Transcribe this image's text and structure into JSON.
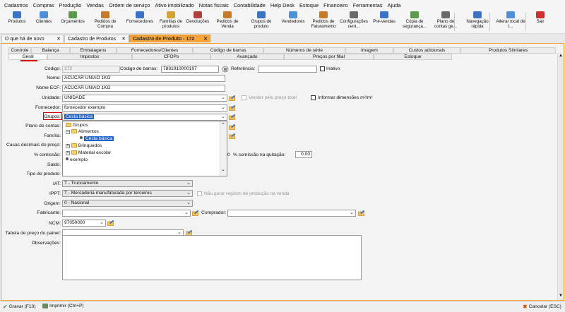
{
  "menu": [
    "Cadastros",
    "Compras",
    "Produção",
    "Vendas",
    "Ordem de serviço",
    "Ativo imobilizado",
    "Notas fiscais",
    "Contabilidade",
    "Help Desk",
    "Estoque",
    "Financeiro",
    "Ferramentas",
    "Ajuda"
  ],
  "toolbar": [
    {
      "label": "Produtos",
      "icon": "box-icon"
    },
    {
      "label": "Clientes",
      "icon": "clients-icon"
    },
    {
      "label": "Orçamentos",
      "icon": "quote-icon"
    },
    {
      "label": "Pedidos de Compra",
      "icon": "purchase-order-icon"
    },
    {
      "label": "Fornecedores",
      "icon": "supplier-icon"
    },
    {
      "label": "Famílias de produtos",
      "icon": "product-family-icon"
    },
    {
      "label": "Devoluções",
      "icon": "return-icon"
    },
    {
      "label": "Pedidos de Venda",
      "icon": "sales-order-icon"
    },
    {
      "label": "Grupos de produto",
      "icon": "product-group-icon"
    },
    {
      "label": "Vendedores",
      "icon": "seller-icon"
    },
    {
      "label": "Pedidos de Faturamento",
      "icon": "billing-icon"
    },
    {
      "label": "Configurações cent...",
      "icon": "settings-icon"
    },
    {
      "label": "Pré-vendas",
      "icon": "cart-icon"
    },
    {
      "label": "Cópia de segurança...",
      "icon": "backup-icon"
    },
    {
      "label": "Plano de contas ge...",
      "icon": "accounts-plan-icon"
    },
    {
      "label": "Navegação rápida",
      "icon": "navigation-icon"
    },
    {
      "label": "Alterar local de t...",
      "icon": "change-location-icon"
    },
    {
      "label": "Sair",
      "icon": "exit-icon"
    }
  ],
  "page_tabs": [
    {
      "label": "O que há de novo"
    },
    {
      "label": "Cadastro de Produtos"
    },
    {
      "label": "Cadastro de Produto - 172",
      "active": true
    }
  ],
  "inner_tabs_row1": [
    "Controle",
    "Balança",
    "Embalagens",
    "Fornecedores/Clientes",
    "Código de barras",
    "Números de série",
    "Imagem",
    "Custos adicionais",
    "Produtos Similares"
  ],
  "inner_tabs_row2": [
    "Geral",
    "Impostos",
    "CFOPs",
    "Avançado",
    "Preços por filial",
    "Estoque"
  ],
  "form": {
    "codigo_label": "Código:",
    "codigo_value": "172",
    "codigo_barras_label": "Código de barras:",
    "codigo_barras_value": "7891910000197",
    "referencia_label": "Referência:",
    "referencia_value": "",
    "inativo_label": "Inativo",
    "nome_label": "Nome:",
    "nome_value": "ACUCAR UNIAO 1KG",
    "nome_ecf_label": "Nome ECF:",
    "nome_ecf_value": "ACUCAR UNIAO 1KG",
    "unidade_label": "Unidade:",
    "unidade_value": "UNIDADE",
    "vender_pelo_preco_total": "Vender pelo preço total",
    "informar_dimensoes": "Informar dimensões m²/m³",
    "fornecedor_label": "Fornecedor:",
    "fornecedor_value": "fornecedor exemplo",
    "grupos_label": "Grupos:",
    "grupos_value": "Cesta básica",
    "plano_contas_label": "Plano de contas:",
    "familia_label": "Família:",
    "casas_decimais_label": "Casas decimais do preço:",
    "comissao_label": "% comissão:",
    "comissao_quitacao_label": "% comissão na quitação:",
    "comissao_quitacao_value": "0,00",
    "saldo_label": "Saldo:",
    "tipo_produto_label": "Tipo de produto:",
    "iat_label": "IAT:",
    "iat_value": "T - Truncamento",
    "ippt_label": "IPPT:",
    "ippt_value": "T - Mercadoria manufaturada por terceiros",
    "nao_gerar_registro": "Não gerar registro de produção na venda",
    "origem_label": "Origem:",
    "origem_value": "0 - Nacional",
    "fabricante_label": "Fabricante:",
    "fabricante_value": "",
    "comprador_label": "Comprador:",
    "comprador_value": "",
    "ncm_label": "NCM:",
    "ncm_value": "97050000",
    "tabela_preco_label": "Tabela de preço do painel:",
    "tabela_preco_value": "",
    "observacoes_label": "Observações:",
    "observacoes_value": ""
  },
  "tree": {
    "root": "Grupos",
    "alimentos": "Alimentos",
    "cesta_basica": "Cesta básica",
    "brinquedos": "Brinquedos",
    "material_escolar": "Material escolar",
    "exemplo": "exemplo"
  },
  "bottom": {
    "gravar": "Gravar (F10)",
    "imprimir": "Imprimir (Ctrl+P)",
    "cancelar": "Cancelar (ESC)"
  }
}
